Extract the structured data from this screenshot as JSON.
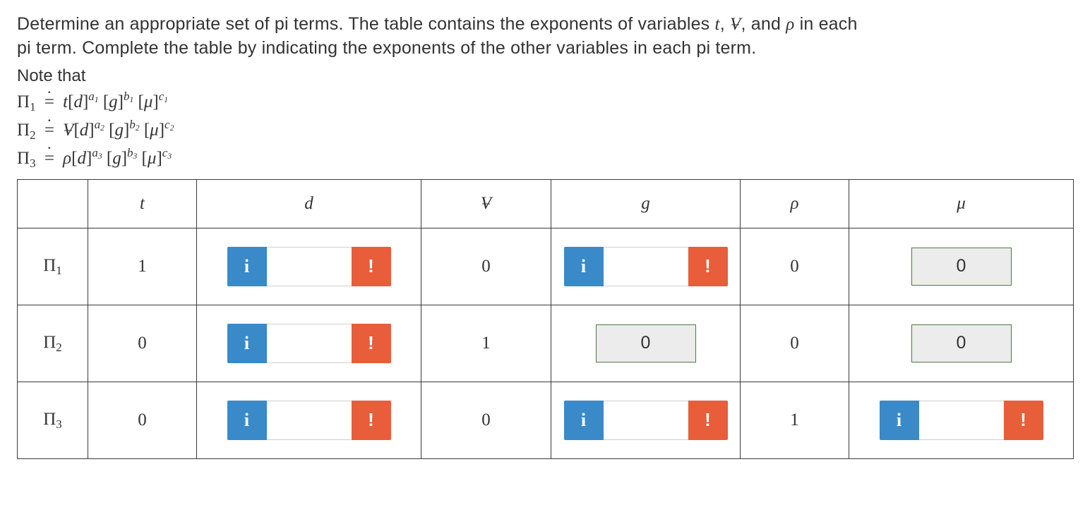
{
  "prompt": {
    "line1_a": "Determine an appropriate set  of  pi  terms. The table contains the exponents of variables ",
    "line1_vars": "t, V, and ρ",
    "line1_b": " in each",
    "line2": "pi term. Complete the table by indicating the exponents of the other variables in each pi term.",
    "note": "Note that"
  },
  "equations": {
    "pi1_label": "Π₁",
    "pi2_label": "Π₂",
    "pi3_label": "Π₃"
  },
  "headers": {
    "t": "t",
    "d": "d",
    "V": "V",
    "g": "g",
    "rho": "ρ",
    "mu": "μ"
  },
  "rows": [
    {
      "label": "Π₁",
      "t": "1",
      "d": {
        "kind": "input",
        "info": "i",
        "warn": "!"
      },
      "V": "0",
      "g": {
        "kind": "input",
        "info": "i",
        "warn": "!"
      },
      "rho": "0",
      "mu": {
        "kind": "filled",
        "value": "0"
      }
    },
    {
      "label": "Π₂",
      "t": "0",
      "d": {
        "kind": "input",
        "info": "i",
        "warn": "!"
      },
      "V": "1",
      "g": {
        "kind": "filled",
        "value": "0"
      },
      "rho": "0",
      "mu": {
        "kind": "filled",
        "value": "0"
      }
    },
    {
      "label": "Π₃",
      "t": "0",
      "d": {
        "kind": "input",
        "info": "i",
        "warn": "!"
      },
      "V": "0",
      "g": {
        "kind": "input",
        "info": "i",
        "warn": "!"
      },
      "rho": "1",
      "mu": {
        "kind": "input",
        "info": "i",
        "warn": "!"
      }
    }
  ],
  "chart_data": {
    "type": "table",
    "columns": [
      "t",
      "d",
      "V",
      "g",
      "ρ",
      "μ"
    ],
    "rows": [
      {
        "label": "Π₁",
        "t": 1,
        "d": null,
        "V": 0,
        "g": null,
        "ρ": 0,
        "μ": 0
      },
      {
        "label": "Π₂",
        "t": 0,
        "d": null,
        "V": 1,
        "g": 0,
        "ρ": 0,
        "μ": 0
      },
      {
        "label": "Π₃",
        "t": 0,
        "d": null,
        "V": 0,
        "g": null,
        "ρ": 1,
        "μ": null
      }
    ],
    "note": "null = blank answer cell awaiting input"
  }
}
